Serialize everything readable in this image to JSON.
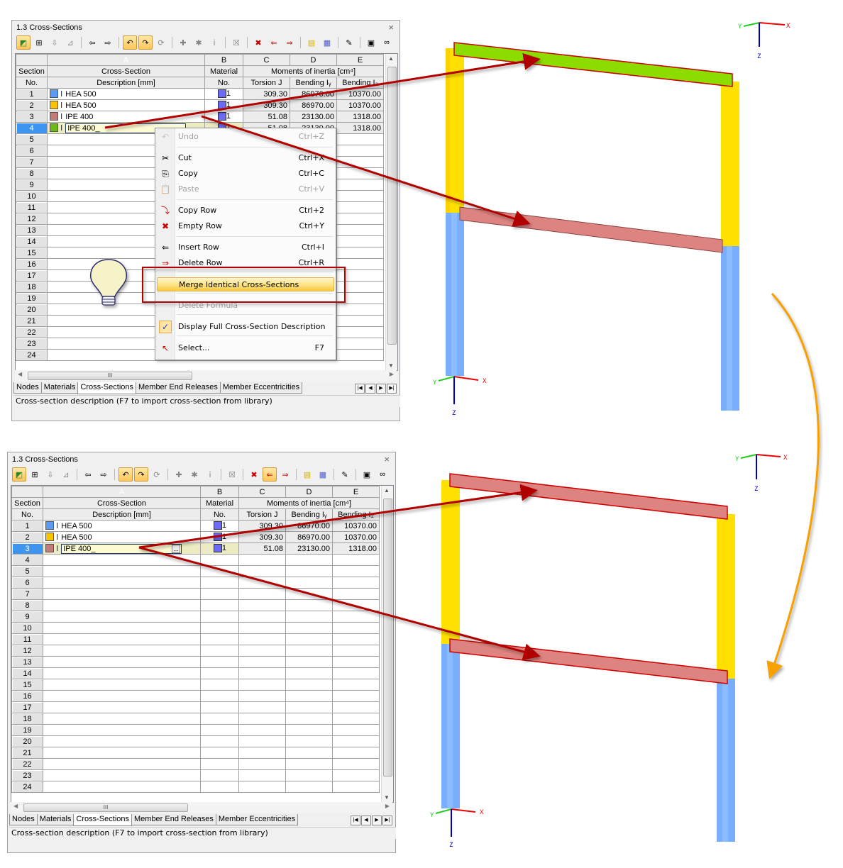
{
  "top_panel": {
    "title": "1.3 Cross-Sections",
    "close_icon": "close-icon",
    "columns": {
      "letters": [
        "A",
        "B",
        "C",
        "D",
        "E"
      ],
      "row_header_1": "Section",
      "row_header_2": "No.",
      "a_1": "Cross-Section",
      "a_2": "Description [mm]",
      "b_1": "Material",
      "b_2": "No.",
      "group": "Moments of inertia [cm⁴]",
      "c_2": "Torsion J",
      "d_2": "Bending Iᵧ",
      "e_2": "Bending I₂"
    },
    "rows": [
      {
        "no": "1",
        "color": "#5b9bf5",
        "desc": "HEA 500",
        "mat": "1",
        "torsion": "309.30",
        "iy": "86970.00",
        "iz": "10370.00"
      },
      {
        "no": "2",
        "color": "#f8c400",
        "desc": "HEA 500",
        "mat": "1",
        "torsion": "309.30",
        "iy": "86970.00",
        "iz": "10370.00"
      },
      {
        "no": "3",
        "color": "#c27c78",
        "desc": "IPE 400",
        "mat": "1",
        "torsion": "51.08",
        "iy": "23130.00",
        "iz": "1318.00"
      },
      {
        "no": "4",
        "color": "#6fb81a",
        "desc": "IPE 400_",
        "mat": "1",
        "torsion": "51.08",
        "iy": "23130.00",
        "iz": "1318.00",
        "selected": true
      }
    ],
    "empty_rows": [
      "5",
      "6",
      "7",
      "8",
      "9",
      "10",
      "11",
      "12",
      "13",
      "14",
      "15",
      "16",
      "17",
      "18",
      "19",
      "20",
      "21",
      "22",
      "23",
      "24"
    ],
    "tabs": [
      "Nodes",
      "Materials",
      "Cross-Sections",
      "Member End Releases",
      "Member Eccentricities"
    ],
    "active_tab": "Cross-Sections",
    "status": "Cross-section description (F7 to import cross-section from library)",
    "hscroll_grip": "III"
  },
  "context_menu": {
    "items": [
      {
        "label": "Undo",
        "shortcut": "Ctrl+Z",
        "icon": "undo-icon",
        "disabled": true
      },
      {
        "label": "Cut",
        "shortcut": "Ctrl+X",
        "icon": "scissors-icon"
      },
      {
        "label": "Copy",
        "shortcut": "Ctrl+C",
        "icon": "copy-icon"
      },
      {
        "label": "Paste",
        "shortcut": "Ctrl+V",
        "icon": "paste-icon",
        "disabled": true
      },
      {
        "label": "Copy Row",
        "shortcut": "Ctrl+2",
        "icon": "copy-row-icon"
      },
      {
        "label": "Empty Row",
        "shortcut": "Ctrl+Y",
        "icon": "empty-row-icon"
      },
      {
        "label": "Insert Row",
        "shortcut": "Ctrl+I",
        "icon": "insert-row-icon"
      },
      {
        "label": "Delete Row",
        "shortcut": "Ctrl+R",
        "icon": "delete-row-icon"
      },
      {
        "label": "Merge Identical Cross-Sections",
        "shortcut": "",
        "icon": "",
        "highlighted": true
      },
      {
        "label": "Delete Formula",
        "shortcut": "",
        "icon": "",
        "disabled": true
      },
      {
        "label": "Display Full Cross-Section Description",
        "shortcut": "",
        "icon": "check-icon",
        "checked": true
      },
      {
        "label": "Select...",
        "shortcut": "F7",
        "icon": "select-cursor-icon"
      }
    ]
  },
  "bottom_panel": {
    "title": "1.3 Cross-Sections",
    "rows": [
      {
        "no": "1",
        "color": "#5b9bf5",
        "desc": "HEA 500",
        "mat": "1",
        "torsion": "309.30",
        "iy": "86970.00",
        "iz": "10370.00"
      },
      {
        "no": "2",
        "color": "#f8c400",
        "desc": "HEA 500",
        "mat": "1",
        "torsion": "309.30",
        "iy": "86970.00",
        "iz": "10370.00"
      },
      {
        "no": "3",
        "color": "#c27c78",
        "desc": "IPE 400_",
        "mat": "1",
        "torsion": "51.08",
        "iy": "23130.00",
        "iz": "1318.00",
        "selected": true
      }
    ],
    "empty_rows": [
      "4",
      "5",
      "6",
      "7",
      "8",
      "9",
      "10",
      "11",
      "12",
      "13",
      "14",
      "15",
      "16",
      "17",
      "18",
      "19",
      "20",
      "21",
      "22",
      "23",
      "24"
    ],
    "browse_button": "...",
    "tabs": [
      "Nodes",
      "Materials",
      "Cross-Sections",
      "Member End Releases",
      "Member Eccentricities"
    ],
    "active_tab": "Cross-Sections",
    "status": "Cross-section description (F7 to import cross-section from library)",
    "hscroll_grip": "III"
  },
  "axes_labels": {
    "x": "X",
    "y": "Y",
    "z": "Z"
  },
  "colors": {
    "column_lower": "#78aefc",
    "column_upper": "#ffe000",
    "beam_top_before": "#8cdc00",
    "beam_pink": "#de8480",
    "annotation_red": "#b00000",
    "annotation_orange": "#f7a000",
    "selection_blue": "#3d95f0"
  }
}
